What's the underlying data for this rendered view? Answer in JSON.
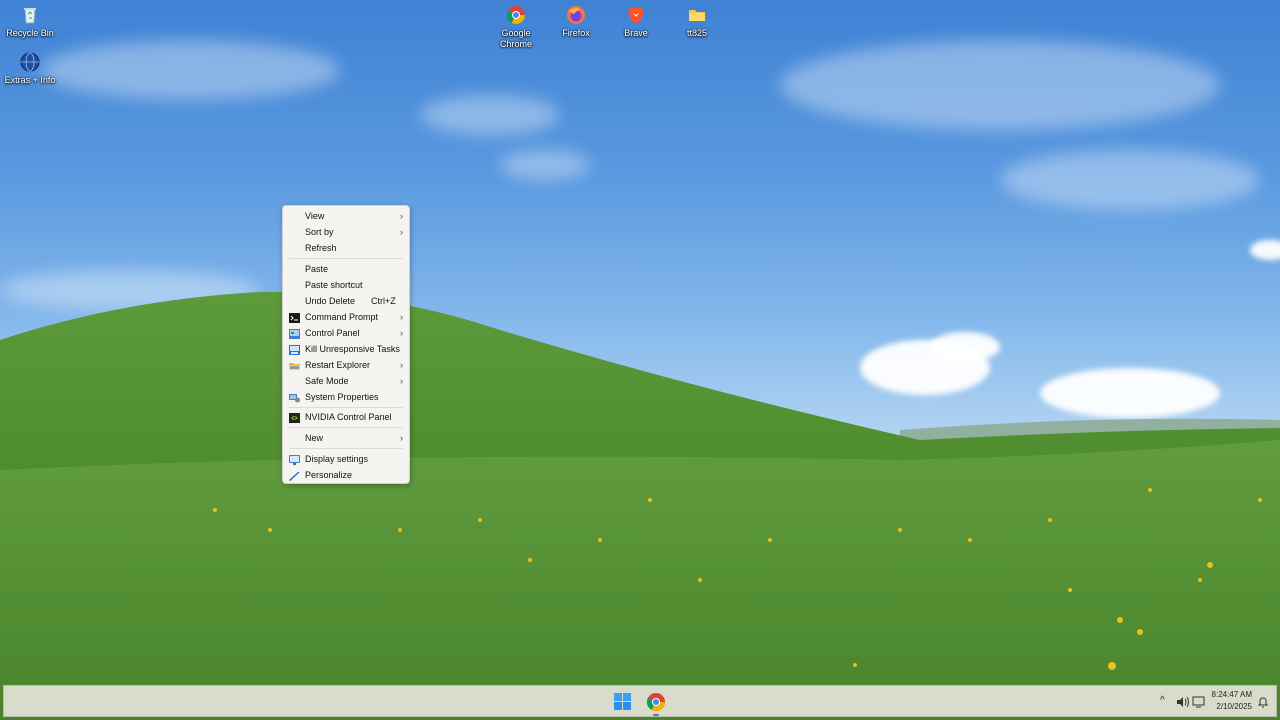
{
  "desktop": {
    "icons": [
      {
        "label": "Recycle Bin",
        "icon": "recycle-bin-icon"
      },
      {
        "label": "Extras + Info",
        "icon": "globe-icon"
      },
      {
        "label": "Google Chrome",
        "icon": "chrome-icon"
      },
      {
        "label": "Firefox",
        "icon": "firefox-icon"
      },
      {
        "label": "Brave",
        "icon": "brave-icon"
      },
      {
        "label": "tt825",
        "icon": "folder-icon"
      }
    ]
  },
  "context_menu": {
    "items": [
      {
        "label": "View",
        "submenu": true
      },
      {
        "label": "Sort by",
        "submenu": true
      },
      {
        "label": "Refresh"
      },
      {
        "label": "Paste"
      },
      {
        "label": "Paste shortcut"
      },
      {
        "label": "Undo Delete",
        "shortcut": "Ctrl+Z"
      },
      {
        "label": "Command Prompt",
        "submenu": true,
        "icon": "command-prompt-icon"
      },
      {
        "label": "Control Panel",
        "submenu": true,
        "icon": "control-panel-icon"
      },
      {
        "label": "Kill Unresponsive Tasks",
        "icon": "kill-tasks-icon"
      },
      {
        "label": "Restart Explorer",
        "submenu": true,
        "icon": "folder-icon"
      },
      {
        "label": "Safe Mode",
        "submenu": true
      },
      {
        "label": "System Properties",
        "icon": "system-properties-icon"
      },
      {
        "label": "NVIDIA Control Panel",
        "icon": "nvidia-icon"
      },
      {
        "label": "New",
        "submenu": true
      },
      {
        "label": "Display settings",
        "icon": "display-icon"
      },
      {
        "label": "Personalize",
        "icon": "pen-icon"
      }
    ],
    "arrow": "›"
  },
  "taskbar": {
    "time": "8:24:47 AM",
    "date": "2/10/2025",
    "tray_chevron": "^"
  },
  "colors": {
    "taskbar_bg": "#d8dccb",
    "menu_bg": "#f6f4f0"
  }
}
